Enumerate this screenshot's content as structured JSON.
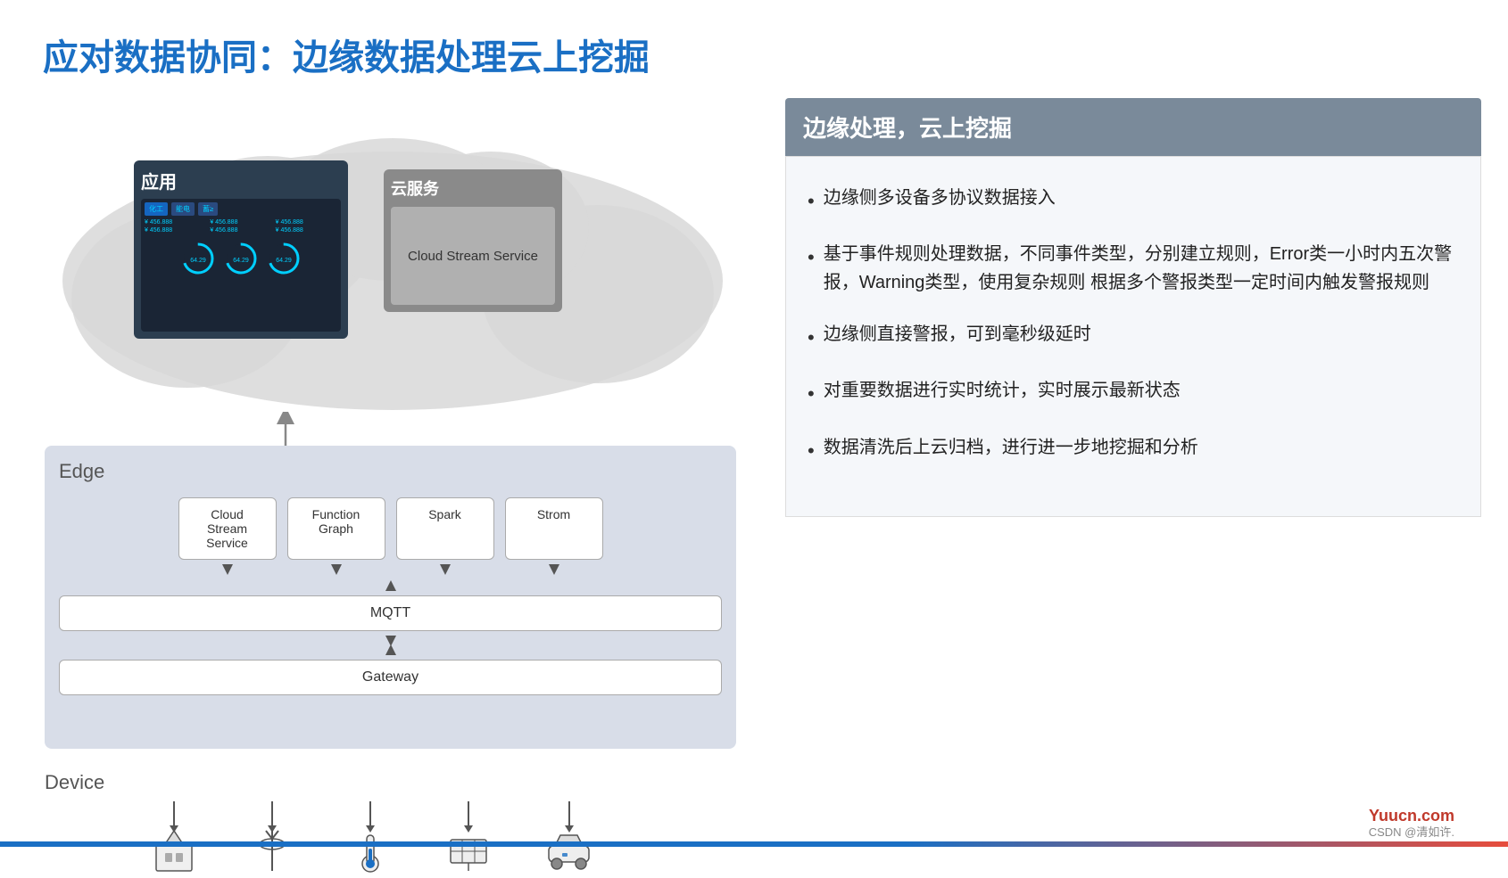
{
  "title": "应对数据协同：边缘数据处理云上挖掘",
  "cloud": {
    "app_label": "应用",
    "cloud_service_label": "云服务",
    "cloud_stream_service": "Cloud Stream\nService",
    "cloud_stream_inner": "Cloud Stream Service"
  },
  "edge": {
    "label": "Edge",
    "services": [
      {
        "name": "Cloud\nStream\nService"
      },
      {
        "name": "Function\nGraph"
      },
      {
        "name": "Spark"
      },
      {
        "name": "Strom"
      }
    ],
    "mqtt": "MQTT",
    "gateway": "Gateway"
  },
  "device": {
    "label": "Device"
  },
  "right": {
    "header": "边缘处理，云上挖掘",
    "bullets": [
      "边缘侧多设备多协议数据接入",
      "基于事件规则处理数据，不同事件类型，分别建立规则，Error类一小时内五次警报，Warning类型，使用复杂规则\n根据多个警报类型一定时间内触发警报规则",
      "边缘侧直接警报，可到毫秒级延时",
      "对重要数据进行实时统计，实时展示最新状态",
      "数据清洗后上云归档，进行进一步地挖掘和分析"
    ]
  },
  "footer": {
    "brand": "Yuucn.com",
    "csdn": "CSDN @清如许."
  }
}
